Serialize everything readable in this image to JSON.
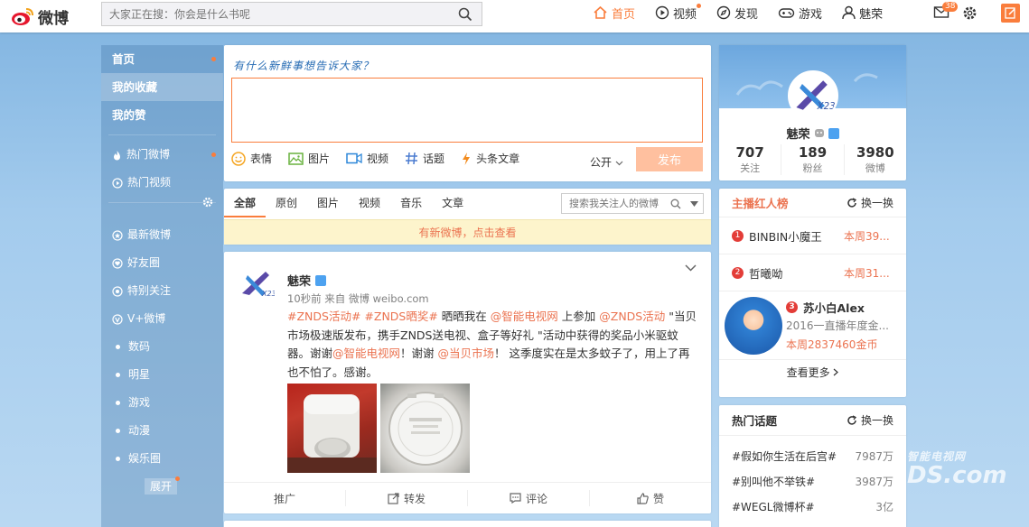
{
  "header": {
    "logo_text": "微博",
    "search_placeholder": "大家正在搜：你会是什么书呢",
    "nav": [
      {
        "label": "首页",
        "icon": "home-icon"
      },
      {
        "label": "视频",
        "icon": "video-play-icon"
      },
      {
        "label": "发现",
        "icon": "compass-icon"
      },
      {
        "label": "游戏",
        "icon": "gamepad-icon"
      },
      {
        "label": "魅荣",
        "icon": "user-icon"
      }
    ],
    "message_count": "38"
  },
  "sidebar": {
    "items": [
      {
        "label": "首页"
      },
      {
        "label": "我的收藏"
      },
      {
        "label": "我的赞"
      },
      {
        "label": "热门微博"
      },
      {
        "label": "热门视频"
      },
      {
        "label": "最新微博"
      },
      {
        "label": "好友圈"
      },
      {
        "label": "特别关注"
      },
      {
        "label": "V+微博"
      },
      {
        "label": "数码"
      },
      {
        "label": "明星"
      },
      {
        "label": "游戏"
      },
      {
        "label": "动漫"
      },
      {
        "label": "娱乐圈"
      }
    ],
    "expand_label": "展开"
  },
  "publisher": {
    "prompt": "有什么新鲜事想告诉大家？",
    "tools": [
      "表情",
      "图片",
      "视频",
      "话题",
      "头条文章"
    ],
    "visibility": "公开",
    "send_label": "发布"
  },
  "filter": {
    "tabs": [
      "全部",
      "原创",
      "图片",
      "视频",
      "音乐",
      "文章"
    ],
    "search_placeholder": "搜索我关注人的微博",
    "new_notice": "有新微博，点击查看"
  },
  "post": {
    "author": "魅荣",
    "meta": "10秒前 来自 微博 weibo.com",
    "parts": [
      {
        "t": "#ZNDS活动#",
        "hl": true
      },
      {
        "t": " ",
        "hl": false
      },
      {
        "t": "#ZNDS晒奖#",
        "hl": true
      },
      {
        "t": " 晒晒我在 ",
        "hl": false
      },
      {
        "t": "@智能电视网",
        "hl": true
      },
      {
        "t": " 上参加 ",
        "hl": false
      },
      {
        "t": "@ZNDS活动",
        "hl": true
      },
      {
        "t": " \"当贝市场极速版发布，携手ZNDS送电视、盒子等好礼 \"活动中获得的奖品小米驱蚊器。谢谢",
        "hl": false
      },
      {
        "t": "@智能电视网",
        "hl": true
      },
      {
        "t": "！谢谢 ",
        "hl": false
      },
      {
        "t": "@当贝市场",
        "hl": true
      },
      {
        "t": "！   这季度实在是太多蚊子了，用上了再也不怕了。感谢。",
        "hl": false
      }
    ],
    "actions": [
      "推广",
      "转发",
      "评论",
      "赞"
    ]
  },
  "profile": {
    "name": "魅荣",
    "stats": [
      {
        "num": "707",
        "label": "关注"
      },
      {
        "num": "189",
        "label": "粉丝"
      },
      {
        "num": "3980",
        "label": "微博"
      }
    ]
  },
  "ranking": {
    "title": "主播红人榜",
    "refresh": "换一换",
    "rows": [
      {
        "rank": "1",
        "name": "BINBIN小魔王",
        "value": "本周39..."
      },
      {
        "rank": "2",
        "name": "哲曦呦",
        "value": "本周31..."
      }
    ],
    "featured": {
      "rank": "3",
      "name": "苏小白Alex",
      "desc": "2016一直播年度金...",
      "value": "本周2837460金币"
    },
    "more": "查看更多"
  },
  "topics": {
    "title": "热门话题",
    "refresh": "换一换",
    "rows": [
      {
        "name": "#假如你生活在后宫#",
        "count": "7987万"
      },
      {
        "name": "#别叫他不举铁#",
        "count": "3987万"
      },
      {
        "name": "#WEGL微博杯#",
        "count": "3亿"
      }
    ]
  },
  "watermark": {
    "line1": "智能电视网",
    "line2": "DS.com"
  },
  "colors": {
    "accent": "#fa7d3c",
    "link": "#eb7350",
    "vip": "#4da2f0"
  }
}
